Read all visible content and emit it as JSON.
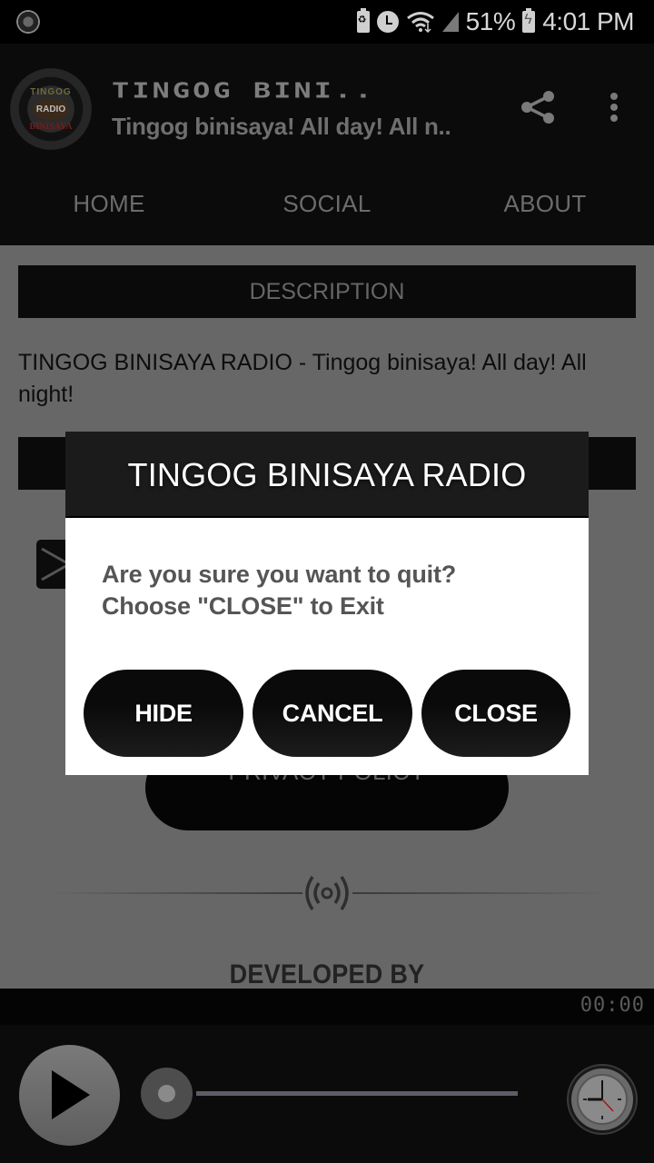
{
  "status_bar": {
    "app_notification_icon": "tingog-logo-icon",
    "icons": [
      "battery-saver-icon",
      "alarm-icon",
      "wifi-icon",
      "signal-icon"
    ],
    "battery_percent": "51%",
    "battery_icon": "battery-charging-icon",
    "time": "4:01 PM"
  },
  "app_bar": {
    "logo": {
      "top": "TINGOG",
      "middle": "RADIO",
      "bottom": "BINISAYA"
    },
    "title": "TINGOG BINI..",
    "subtitle": "Tingog binisaya! All day! All n..",
    "share_icon": "share-icon",
    "more_icon": "more-vert-icon"
  },
  "tabs": [
    {
      "label": "HOME"
    },
    {
      "label": "SOCIAL"
    },
    {
      "label": "ABOUT"
    }
  ],
  "content": {
    "description_header": "DESCRIPTION",
    "description_text": "TINGOG BINISAYA RADIO - Tingog binisaya! All day! All night!",
    "second_header": "",
    "privacy_button": "PRIVACY POLICY",
    "divider_icon": "radio-broadcast-icon",
    "developed_by": "DEVELOPED BY"
  },
  "player": {
    "timer": "00:00",
    "play_icon": "play-icon",
    "progress": 0,
    "clock_icon": "sleep-timer-clock-icon"
  },
  "dialog": {
    "title": "TINGOG BINISAYA RADIO",
    "message_line1": "Are you sure you want to quit?",
    "message_line2": "Choose \"CLOSE\" to Exit",
    "buttons": [
      {
        "label": "HIDE"
      },
      {
        "label": "CANCEL"
      },
      {
        "label": "CLOSE"
      }
    ]
  }
}
